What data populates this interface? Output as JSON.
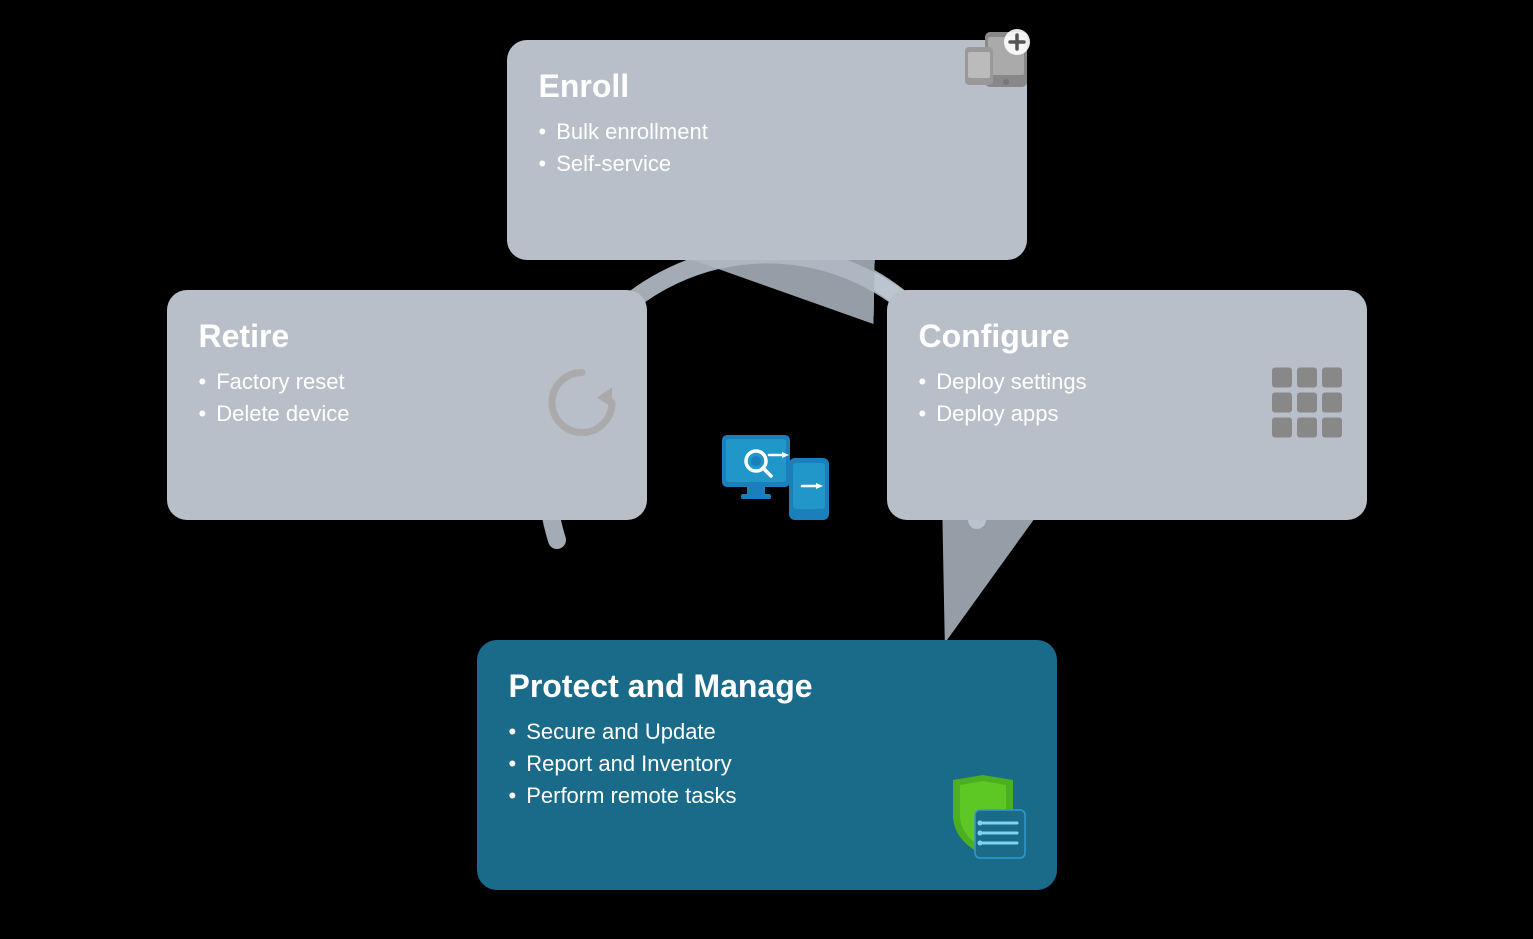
{
  "cards": {
    "enroll": {
      "title": "Enroll",
      "items": [
        "Bulk enrollment",
        "Self-service"
      ]
    },
    "configure": {
      "title": "Configure",
      "items": [
        "Deploy settings",
        "Deploy apps"
      ]
    },
    "protect": {
      "title": "Protect and Manage",
      "items": [
        "Secure and Update",
        "Report and Inventory",
        "Perform remote tasks"
      ]
    },
    "retire": {
      "title": "Retire",
      "items": [
        "Factory reset",
        "Delete device"
      ]
    }
  },
  "colors": {
    "card_default": "#b8bfc8",
    "card_protect": "#1a6b8a",
    "background": "#000000",
    "arrow": "#c5cdd6"
  }
}
